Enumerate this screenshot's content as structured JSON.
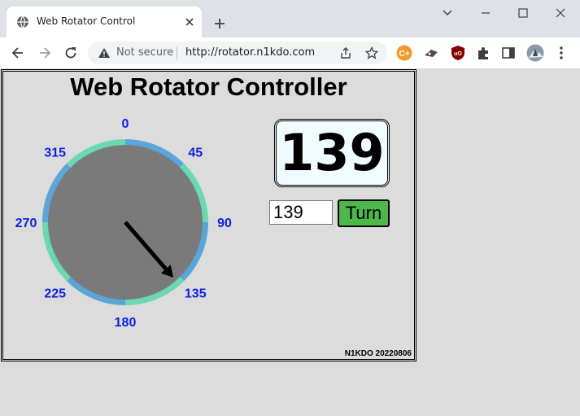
{
  "browser": {
    "tab_title": "Web Rotator Control",
    "omnibox": {
      "security_label": "Not secure",
      "url": "http://rotator.n1kdo.com"
    },
    "icons": {
      "favicon": "globe-icon",
      "tab_close": "close-icon",
      "new_tab": "plus-icon",
      "back": "back-arrow-icon",
      "forward": "forward-arrow-icon",
      "reload": "reload-icon",
      "warning": "warning-icon",
      "share": "share-icon",
      "bookmark": "star-icon",
      "extensions": "puzzle-icon",
      "side_panel": "side-panel-icon",
      "profile": "avatar-icon",
      "menu": "kebab-menu-icon",
      "minimize": "minimize-icon",
      "maximize": "maximize-icon",
      "window_close": "window-close-icon",
      "tab_search": "chevron-down-icon"
    }
  },
  "app": {
    "title": "Web Rotator Controller",
    "current_heading": "139",
    "input_value": "139",
    "turn_label": "Turn",
    "version": "N1KDO 20220806",
    "dial": {
      "bearing_deg": 139,
      "labels": [
        "0",
        "45",
        "90",
        "135",
        "180",
        "225",
        "270",
        "315"
      ],
      "colors": {
        "face": "#7a7a7a",
        "ring_blue": "#5aa6d8",
        "ring_green": "#6ad8b0",
        "label": "#1020e0",
        "needle": "#000000"
      }
    },
    "colors": {
      "turn_button": "#4cb849",
      "heading_bg": "#f0fcff"
    }
  }
}
